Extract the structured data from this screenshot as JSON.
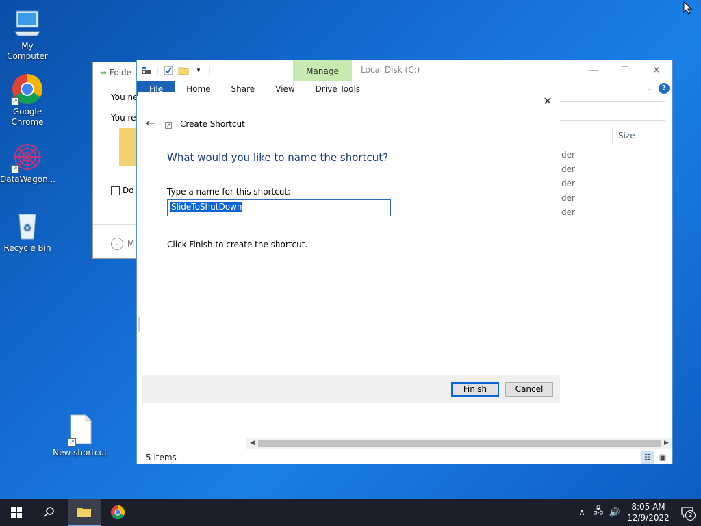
{
  "desktop": {
    "icons": [
      {
        "label": "My Computer"
      },
      {
        "label": "Google Chrome"
      },
      {
        "label": "DataWagon..."
      },
      {
        "label": "Recycle Bin"
      },
      {
        "label": "New shortcut"
      }
    ]
  },
  "back_window": {
    "title": "Folde",
    "line1": "You ne",
    "line2": "You re",
    "checkbox_label": "Do",
    "more_label": "M"
  },
  "explorer": {
    "title": "Local Disk (C:)",
    "manage_tab": "Manage",
    "ribbon_tabs": [
      "File",
      "Home",
      "Share",
      "View",
      "Drive Tools"
    ],
    "column_size": "Size",
    "row_type_fragments": [
      "der",
      "der",
      "der",
      "der",
      "der"
    ],
    "status": "5 items"
  },
  "wizard": {
    "title": "Create Shortcut",
    "heading": "What would you like to name the shortcut?",
    "name_label": "Type a name for this shortcut:",
    "name_value": "SlideToShutDown",
    "info": "Click Finish to create the shortcut.",
    "finish_label": "Finish",
    "cancel_label": "Cancel"
  },
  "taskbar": {
    "time": "8:05 AM",
    "date": "12/9/2022",
    "notification_count": "2"
  },
  "colors": {
    "accent": "#0a64d6",
    "file_tab": "#1a63b8",
    "manage_tab": "#c6eab0",
    "heading": "#1d3c7a"
  }
}
